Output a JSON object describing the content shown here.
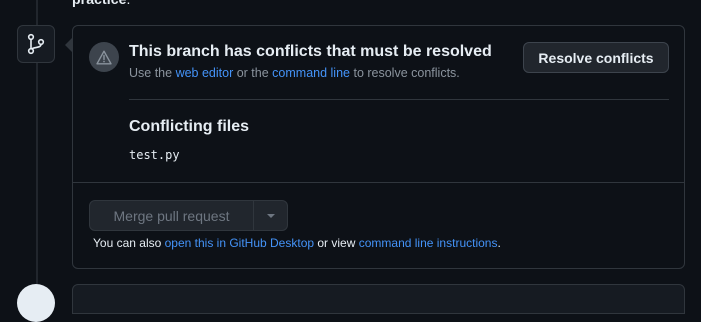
{
  "top_text": {
    "bold": "practice",
    "rest": "."
  },
  "badge": {
    "icon": "git-branch-icon"
  },
  "conflict": {
    "icon": "alert-icon",
    "title": "This branch has conflicts that must be resolved",
    "sub_prefix": "Use the ",
    "web_editor_link": "web editor",
    "sub_middle": " or the ",
    "command_line_link": "command line",
    "sub_suffix": " to resolve conflicts.",
    "resolve_button": "Resolve conflicts"
  },
  "files": {
    "heading": "Conflicting files",
    "items": [
      "test.py"
    ]
  },
  "merge": {
    "button_label": "Merge pull request",
    "caret_icon": "triangle-down-icon",
    "note_prefix": "You can also ",
    "desktop_link": "open this in GitHub Desktop",
    "note_middle": " or view ",
    "instructions_link": "command line instructions",
    "note_suffix": "."
  },
  "colors": {
    "background": "#0d1117",
    "border": "#30363d",
    "link": "#4493f8",
    "muted": "#8b949e"
  }
}
